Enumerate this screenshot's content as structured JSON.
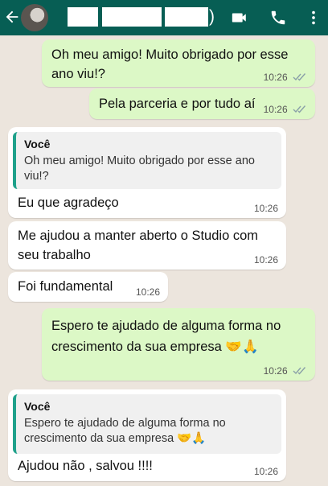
{
  "header": {
    "video_icon": "video-call-icon",
    "phone_icon": "voice-call-icon",
    "menu_icon": "more-options-icon",
    "paren_open": "(",
    "paren_close": ")",
    "bg_color": "#075e54"
  },
  "messages": [
    {
      "direction": "outgoing",
      "text": "Oh meu amigo! Muito obrigado por esse ano viu!?",
      "time": "10:26",
      "status": "read"
    },
    {
      "direction": "outgoing",
      "text": "Pela parceria e por tudo aí",
      "time": "10:26",
      "status": "read"
    },
    {
      "direction": "incoming",
      "quote_author": "Você",
      "quote_text": "Oh meu amigo! Muito obrigado por esse ano viu!?",
      "text": "Eu que agradeço",
      "time": "10:26"
    },
    {
      "direction": "incoming",
      "text": "Me ajudou a manter aberto o Studio com seu trabalho",
      "time": "10:26"
    },
    {
      "direction": "incoming",
      "text": "Foi fundamental",
      "time": "10:26"
    },
    {
      "direction": "outgoing",
      "text": "Espero te ajudado de alguma forma no crescimento da sua empresa 🤝🙏",
      "time": "10:26",
      "status": "read"
    },
    {
      "direction": "incoming",
      "quote_author": "Você",
      "quote_text": "Espero te ajudado de alguma forma no crescimento da sua empresa 🤝🙏",
      "text": "Ajudou não , salvou !!!!",
      "time": "10:26"
    }
  ],
  "colors": {
    "outgoing_bubble": "#dcf8c6",
    "incoming_bubble": "#ffffff",
    "chat_background": "#ece5dd",
    "quote_bar": "#1fa18b"
  }
}
